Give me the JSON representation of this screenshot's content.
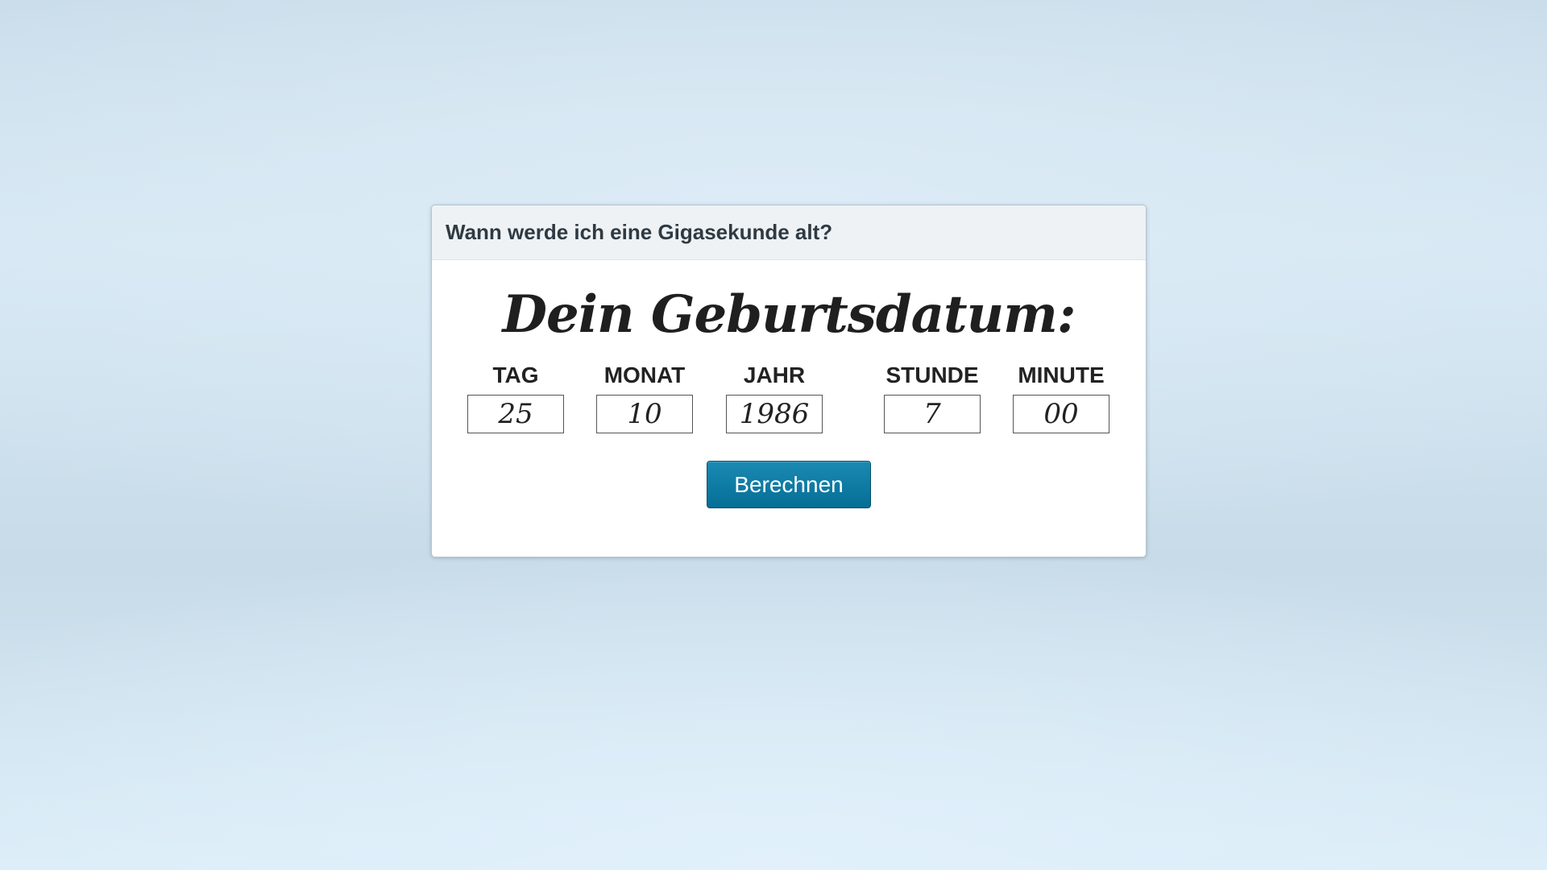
{
  "panel": {
    "title": "Wann werde ich eine Gigasekunde alt?"
  },
  "heading": "Dein Geburtsdatum:",
  "fields": [
    {
      "label": "TAG",
      "value": "25"
    },
    {
      "label": "MONAT",
      "value": "10"
    },
    {
      "label": "JAHR",
      "value": "1986"
    },
    {
      "label": "STUNDE",
      "value": "7"
    },
    {
      "label": "MINUTE",
      "value": "00"
    }
  ],
  "button": {
    "label": "Berechnen"
  },
  "colors": {
    "button": "#0a7aa4",
    "panel_header": "#eef2f5",
    "background": "#d3e6f2"
  }
}
